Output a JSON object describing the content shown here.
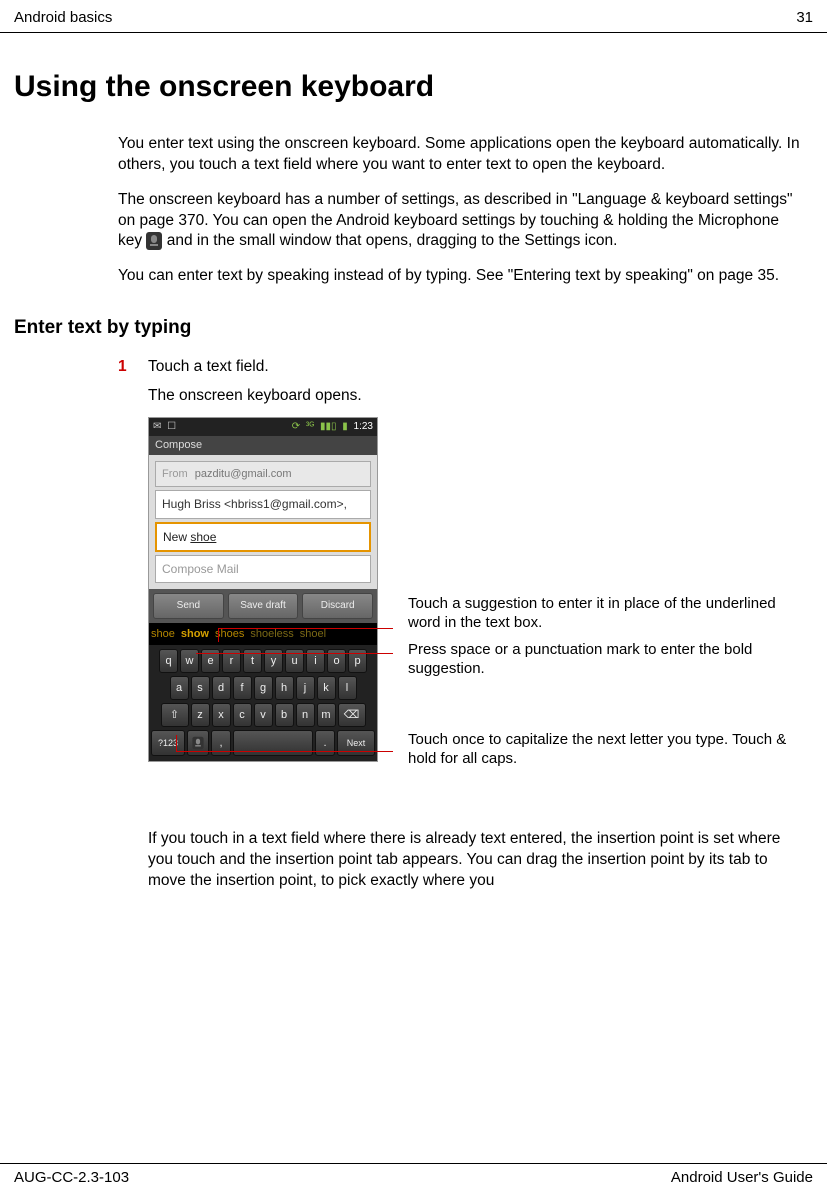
{
  "header": {
    "left": "Android basics",
    "right": "31"
  },
  "footer": {
    "left": "AUG-CC-2.3-103",
    "right": "Android User's Guide"
  },
  "title": "Using the onscreen keyboard",
  "intro": [
    "You enter text using the onscreen keyboard. Some applications open the keyboard automatically. In others, you touch a text field where you want to enter text to open the keyboard.",
    "The onscreen keyboard has a number of settings, as described in \"Language & keyboard settings\" on page 370. You can open the Android keyboard settings by touching & holding the Microphone key",
    "and in the small window that opens, dragging to the Settings icon.",
    "You can enter text by speaking instead of by typing. See \"Entering text by speaking\" on page 35."
  ],
  "section_heading": "Enter text by typing",
  "step": {
    "num": "1",
    "text": "Touch a text field."
  },
  "step_result": "The onscreen keyboard opens.",
  "after_image": "If you touch in a text field where there is already text entered, the insertion point is set where you touch and the insertion point tab appears. You can drag the insertion point by its tab to move the insertion point, to pick exactly where you",
  "phone": {
    "time": "1:23",
    "compose": "Compose",
    "from_label": "From",
    "from_value": "pazditu@gmail.com",
    "to": "Hugh Briss <hbriss1@gmail.com>,",
    "subject_prefix": "New ",
    "subject_word": "shoe",
    "compose_placeholder": "Compose Mail",
    "buttons": {
      "send": "Send",
      "save": "Save draft",
      "discard": "Discard"
    },
    "suggestions": [
      "shoe",
      "show",
      "shoes",
      "shoeless",
      "shoel"
    ],
    "rows": {
      "r1": [
        "q",
        "w",
        "e",
        "r",
        "t",
        "y",
        "u",
        "i",
        "o",
        "p"
      ],
      "r2": [
        "a",
        "s",
        "d",
        "f",
        "g",
        "h",
        "j",
        "k",
        "l"
      ],
      "r3": [
        "z",
        "x",
        "c",
        "v",
        "b",
        "n",
        "m"
      ]
    },
    "shift": "⇧",
    "del": "⌫",
    "q123": "?123",
    "comma": ",",
    "period": ".",
    "next": "Next"
  },
  "callouts": {
    "c1": "Touch a suggestion to enter it in place of the underlined word in the text box.",
    "c2": "Press space or a punctuation mark to enter the bold suggestion.",
    "c3": "Touch once to capitalize the next letter you type. Touch & hold for all caps."
  }
}
